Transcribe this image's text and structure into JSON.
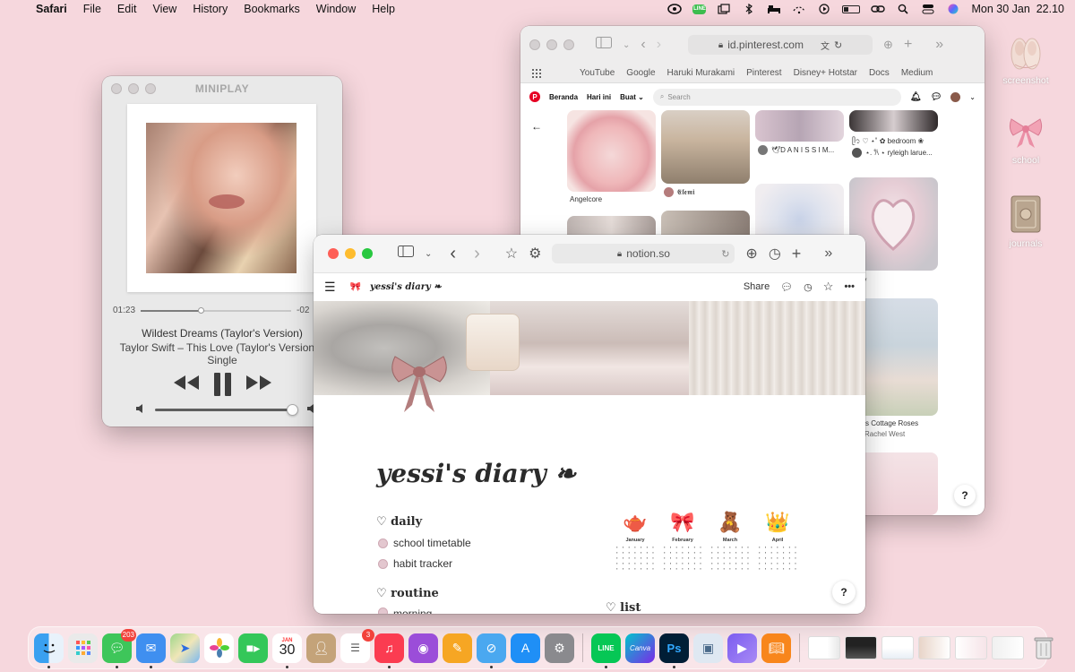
{
  "menubar": {
    "app_name": "Safari",
    "menus": [
      "File",
      "Edit",
      "View",
      "History",
      "Bookmarks",
      "Window",
      "Help"
    ],
    "line_badge": "LINE",
    "clock": "Mon 30 Jan  22.10"
  },
  "desktop_icons": [
    {
      "label": "screenshot",
      "icon": "ballet-shoes"
    },
    {
      "label": "school",
      "icon": "pink-bow"
    },
    {
      "label": "journals",
      "icon": "vintage-book"
    }
  ],
  "miniplay": {
    "title": "MINIPLAY",
    "elapsed": "01:23",
    "remaining": "-02",
    "progress": 0.4,
    "track_title": "Wildest Dreams (Taylor's Version)",
    "track_artist": "Taylor Swift – This Love (Taylor's Version) - Single",
    "volume": 1.0
  },
  "pinterest_window": {
    "url": "id.pinterest.com",
    "bookmarks": [
      "YouTube",
      "Google",
      "Haruki Murakami",
      "Pinterest",
      "Disney+ Hotstar",
      "Docs",
      "Medium"
    ],
    "nav": {
      "home": "Beranda",
      "today": "Hari ini",
      "create": "Buat",
      "search_placeholder": "Search"
    },
    "pins": {
      "angelcore": "Angelcore",
      "user1": "𝕰𝖑𝖊𝖒𝖎",
      "user2": "🕊D A N I S S I M...",
      "caption_bedroom": "ᥫ᭡ ♡ ⋆˚ ✿ bedroom ❀",
      "caption_ryleigh": "⋆. 𐙚 ⋆ ryleigh larue...",
      "caption_raley": "raley",
      "caption_cottage": "dy's Cottage Roses",
      "caption_rachel": "Rachel West"
    },
    "help": "?"
  },
  "notion_window": {
    "url": "notion.so",
    "breadcrumb": "yessi's diary ❧",
    "share": "Share",
    "title": "yessi's diary ❧",
    "daily": {
      "heading": "♡ daily",
      "items": [
        "school timetable",
        "habit tracker"
      ]
    },
    "routine": {
      "heading": "♡ routine",
      "items": [
        "morning"
      ]
    },
    "list": {
      "heading": "♡ list"
    },
    "calendars": [
      {
        "month": "January",
        "emoji": "🫖"
      },
      {
        "month": "February",
        "emoji": "🎀"
      },
      {
        "month": "March",
        "emoji": "🧸"
      },
      {
        "month": "April",
        "emoji": "👑"
      }
    ],
    "help": "?"
  },
  "dock": {
    "calendar_month": "JAN",
    "calendar_day": "30",
    "messages_badge": "203",
    "reminders_badge": "3",
    "canva_label": "Canva",
    "ps_label": "Ps",
    "line_label": "LINE"
  },
  "colors": {
    "desktop": "#f6d7dd",
    "accent_red": "#fe5f57",
    "accent_yellow": "#febc2e",
    "accent_green": "#28c840",
    "pinterest_red": "#e60023"
  }
}
